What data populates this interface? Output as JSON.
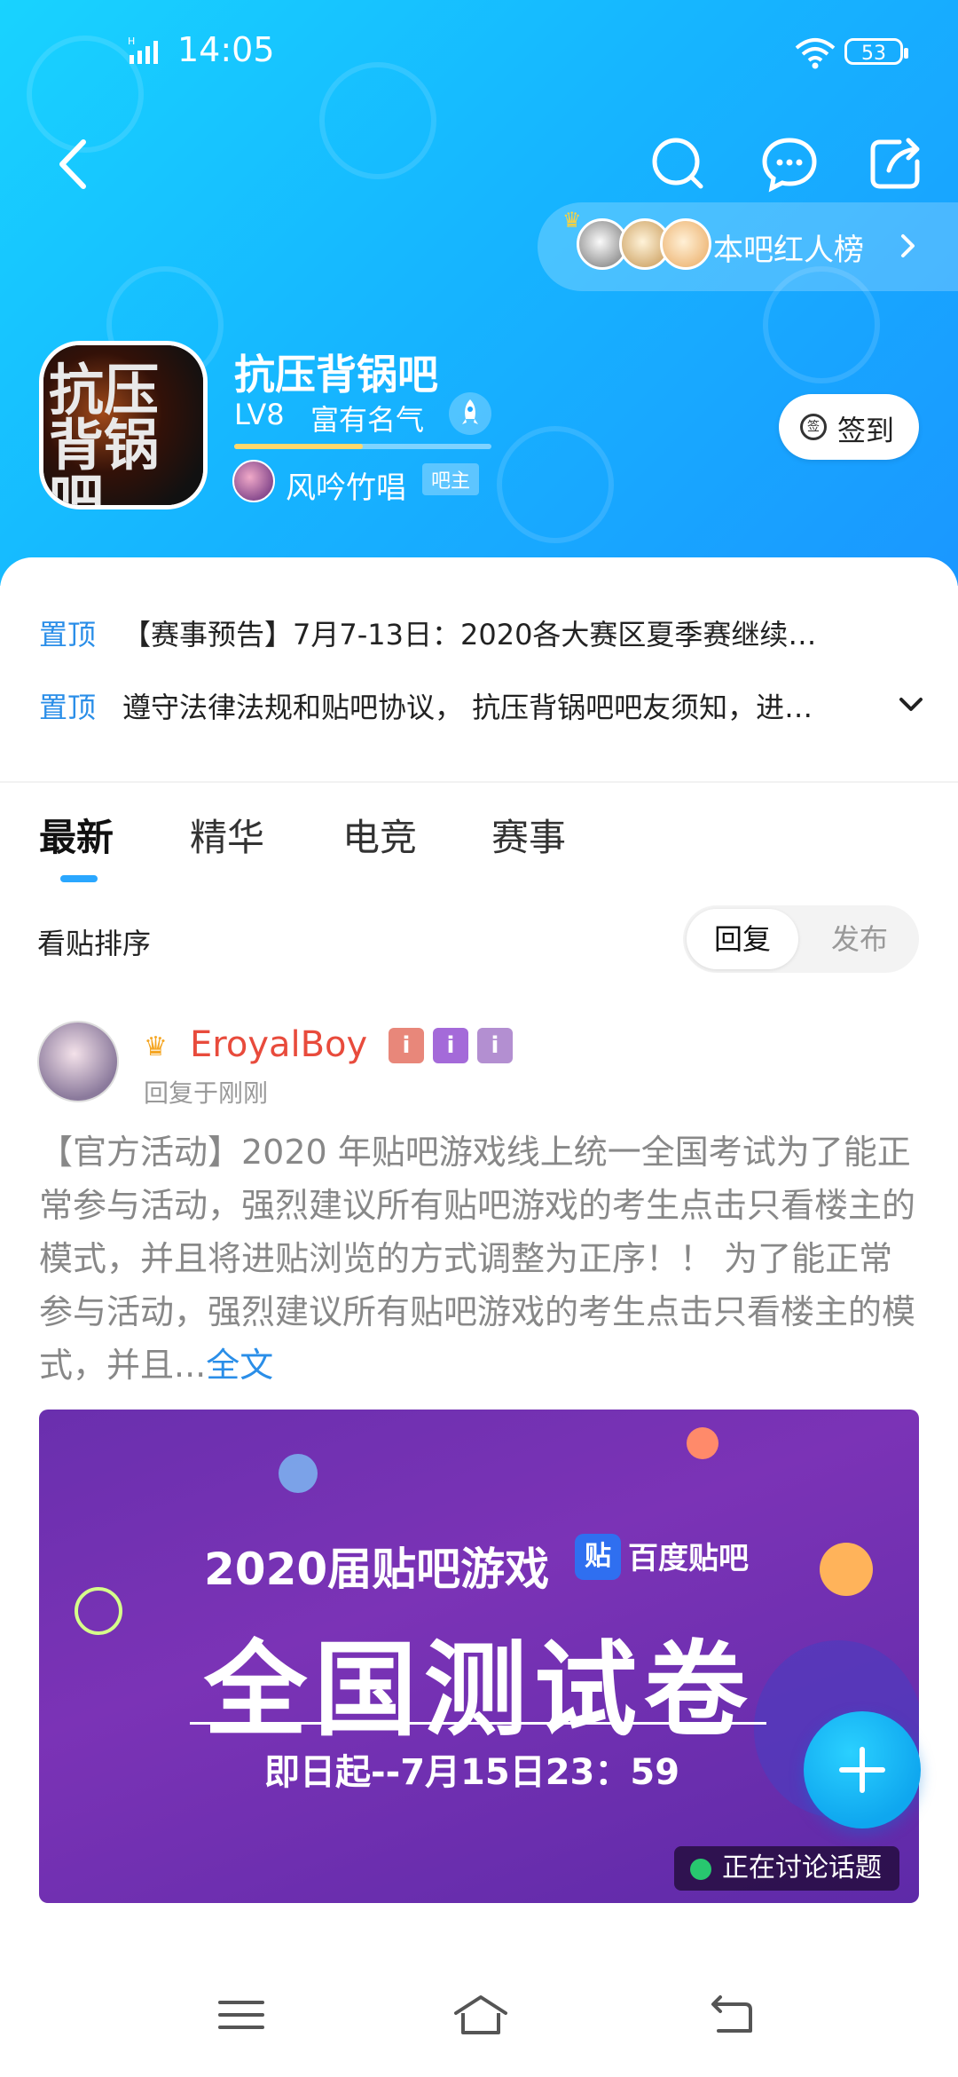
{
  "status_bar": {
    "time": "14:05",
    "battery": "53"
  },
  "header": {
    "hot_list_label": "本吧红人榜",
    "forum_name": "抗压背锅吧",
    "forum_logo_text": "抗压背锅吧",
    "level": "LV8",
    "rank_title": "富有名气",
    "exp_progress": 0.5,
    "owner_name": "风吟竹唱",
    "owner_tag": "吧主",
    "checkin_label": "签到",
    "checkin_icon_char": "签"
  },
  "pinned": [
    {
      "tag": "置顶",
      "text": "【赛事预告】7月7-13日：2020各大赛区夏季赛继续…"
    },
    {
      "tag": "置顶",
      "text": "遵守法律法规和贴吧协议， 抗压背锅吧吧友须知，进…"
    }
  ],
  "tabs": [
    "最新",
    "精华",
    "电竞",
    "赛事"
  ],
  "sort": {
    "label": "看贴排序",
    "options": [
      "回复",
      "发布"
    ],
    "selected": "回复"
  },
  "post": {
    "author": "EroyalBoy",
    "badges": [
      "i",
      "i",
      "i"
    ],
    "reply_time": "回复于刚刚",
    "body": "【官方活动】2020 年贴吧游戏线上统一全国考试为了能正常参与活动，强烈建议所有贴吧游戏的考生点击只看楼主的模式，并且将进贴浏览的方式调整为正序！！ 为了能正常参与活动，强烈建议所有贴吧游戏的考生点击只看楼主的模式，并且...",
    "more_label": "全文",
    "banner": {
      "subtitle": "2020届贴吧游戏",
      "brand": "百度贴吧",
      "brand_icon_char": "贴",
      "title": "全国测试卷",
      "date": "即日起--7月15日23：59",
      "topic_chip": "正在讨论话题"
    }
  },
  "colors": {
    "accent": "#2aa7ff",
    "pin": "#2a8ee8",
    "author": "#e84b3c",
    "header_start": "#18d3ff",
    "header_end": "#1a97ff"
  }
}
